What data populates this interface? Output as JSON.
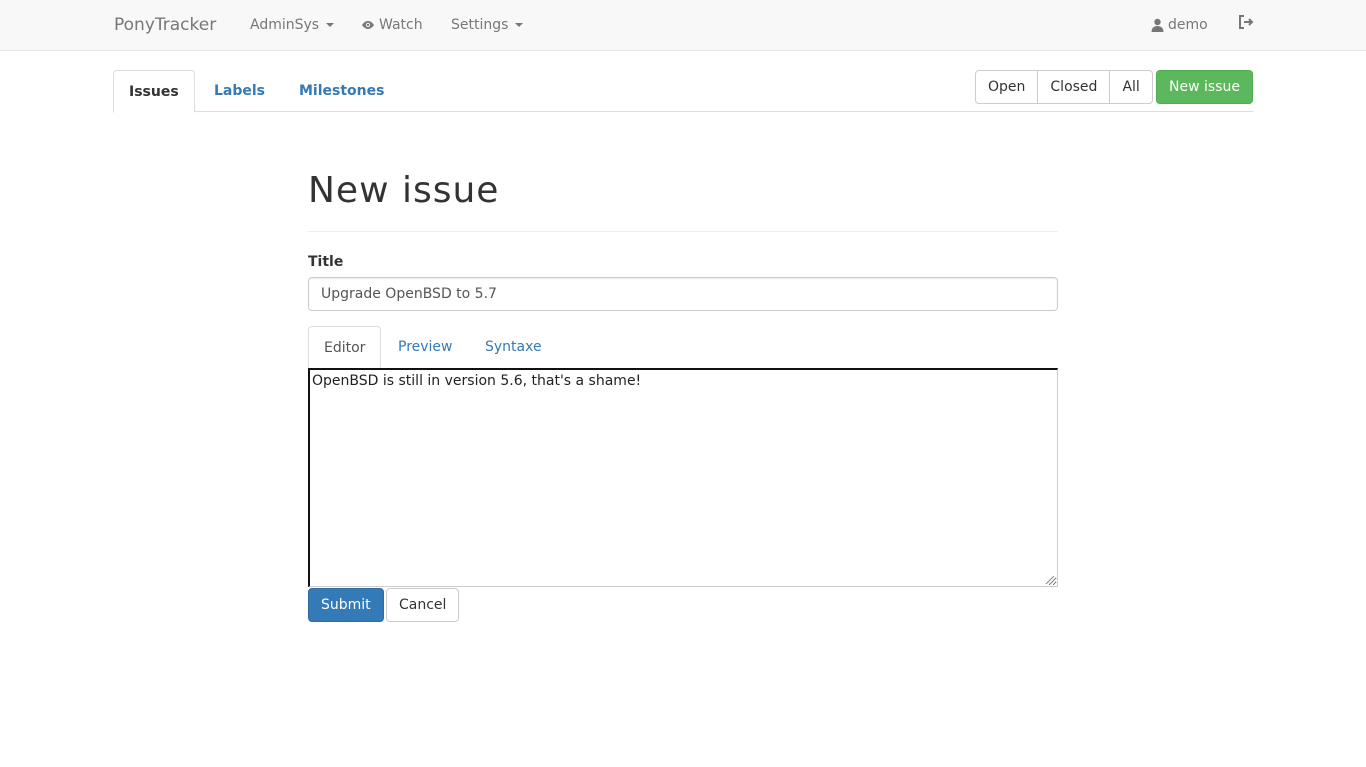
{
  "navbar": {
    "brand": "PonyTracker",
    "project_menu": "AdminSys",
    "watch": "Watch",
    "settings": "Settings",
    "user": "demo"
  },
  "tabs": {
    "issues": "Issues",
    "labels": "Labels",
    "milestones": "Milestones"
  },
  "filters": {
    "open": "Open",
    "closed": "Closed",
    "all": "All"
  },
  "new_issue_button": "New issue",
  "form": {
    "heading": "New issue",
    "title_label": "Title",
    "title_value": "Upgrade OpenBSD to 5.7",
    "editor_tabs": [
      "Editor",
      "Preview",
      "Syntaxe"
    ],
    "body_value": "OpenBSD is still in version 5.6, that's a shame!",
    "submit": "Submit",
    "cancel": "Cancel"
  },
  "colors": {
    "link": "#337ab7",
    "success": "#5cb85c",
    "primary": "#337ab7"
  },
  "icons": {
    "watch": "eye-icon",
    "user": "user-icon",
    "logout": "logout-icon"
  }
}
